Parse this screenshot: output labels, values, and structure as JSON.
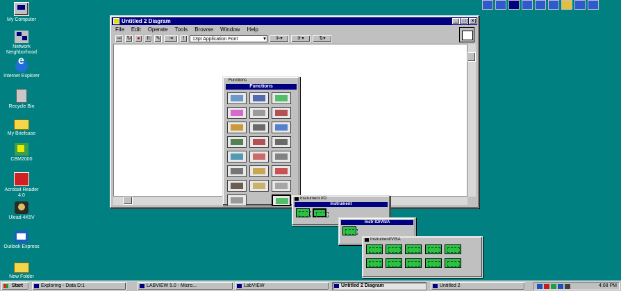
{
  "desktop": {
    "icons": [
      {
        "label": "My Computer",
        "icon": "computer-icon"
      },
      {
        "label": "Network Neighborhood",
        "icon": "network-icon"
      },
      {
        "label": "Internet Explorer",
        "icon": "internet-explorer-icon"
      },
      {
        "label": "Recycle Bin",
        "icon": "recycle-bin-icon"
      },
      {
        "label": "My Briefcase",
        "icon": "briefcase-icon"
      },
      {
        "label": "CBM2000",
        "icon": "cbm-icon"
      },
      {
        "label": "Acrobat Reader 4.0",
        "icon": "acrobat-icon"
      },
      {
        "label": "Ulead 4K5V",
        "icon": "ulead-icon"
      },
      {
        "label": "Outlook Express",
        "icon": "outlook-express-icon"
      },
      {
        "label": "New Folder",
        "icon": "folder-icon"
      }
    ]
  },
  "diagram_window": {
    "title": "Untitled 2 Diagram",
    "menu": [
      "File",
      "Edit",
      "Operate",
      "Tools",
      "Browse",
      "Window",
      "Help"
    ],
    "font_select": "13pt Application Font"
  },
  "functions_palette": {
    "title": "Functions",
    "subtitle": "Functions"
  },
  "sub_palette_1": {
    "title": "Instrument I/O",
    "header": "Instrument"
  },
  "sub_palette_2": {
    "title": "Instrument",
    "header": "Instr IO/VISA"
  },
  "sub_palette_3": {
    "title": "Instrument/VISA"
  },
  "taskbar": {
    "start": "Start",
    "buttons": [
      "Exploring - Data D:1",
      "LABVIEW 5.0 - Micro...",
      "LabVIEW",
      "Untitled 2 Diagram",
      "Untitled 2"
    ],
    "clock": "4:08 PM"
  }
}
